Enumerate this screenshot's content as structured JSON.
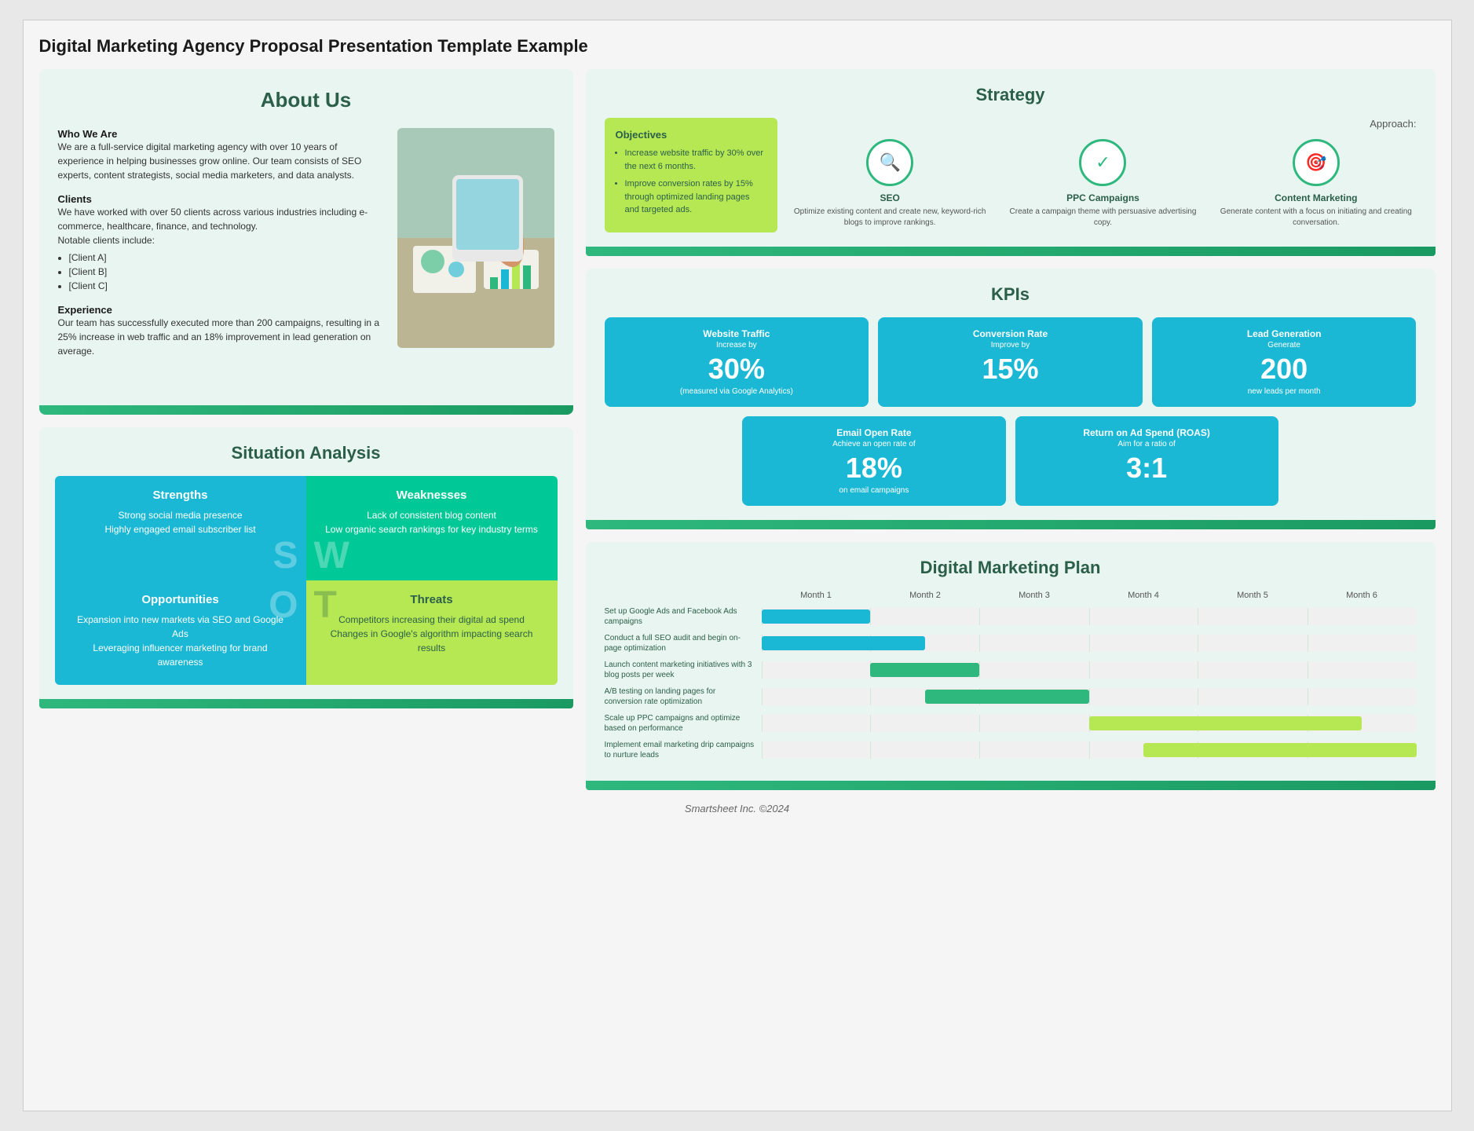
{
  "page": {
    "title": "Digital Marketing Agency Proposal Presentation Template Example",
    "footer": "Smartsheet Inc. ©2024"
  },
  "about": {
    "title": "About Us",
    "sections": [
      {
        "title": "Who We Are",
        "body": "We are a full-service digital marketing agency with over 10 years of experience in helping businesses grow online. Our team consists of SEO experts, content strategists, social media marketers, and data analysts."
      },
      {
        "title": "Clients",
        "body": "We have worked with over 50 clients across various industries including e-commerce, healthcare, finance, and technology.",
        "notable": "Notable clients include:",
        "clients": [
          "[Client A]",
          "[Client B]",
          "[Client C]"
        ]
      },
      {
        "title": "Experience",
        "body": "Our team has successfully executed more than 200 campaigns, resulting in a 25% increase in web traffic and an 18% improvement in lead generation on average."
      }
    ]
  },
  "situation": {
    "title": "Situation Analysis",
    "swot": {
      "strengths": {
        "title": "Strengths",
        "letter": "S",
        "items": [
          "Strong social media presence",
          "Highly engaged email subscriber list"
        ]
      },
      "weaknesses": {
        "title": "Weaknesses",
        "letter": "W",
        "items": [
          "Lack of consistent blog content",
          "Low organic search rankings for key industry terms"
        ]
      },
      "opportunities": {
        "title": "Opportunities",
        "letter": "O",
        "items": [
          "Expansion into new markets via SEO and Google Ads",
          "Leveraging influencer marketing for brand awareness"
        ]
      },
      "threats": {
        "title": "Threats",
        "letter": "T",
        "items": [
          "Competitors increasing their digital ad spend",
          "Changes in Google's algorithm impacting search results"
        ]
      }
    }
  },
  "strategy": {
    "title": "Strategy",
    "objectives": {
      "title": "Objectives",
      "items": [
        "Increase website traffic by 30% over the next 6 months.",
        "Improve conversion rates by 15% through optimized landing pages and targeted ads."
      ]
    },
    "approach_label": "Approach:",
    "approaches": [
      {
        "icon": "🔍",
        "title": "SEO",
        "body": "Optimize existing content and create new, keyword-rich blogs to improve rankings."
      },
      {
        "icon": "✓",
        "title": "PPC Campaigns",
        "body": "Create a campaign theme with persuasive advertising copy."
      },
      {
        "icon": "🎯",
        "title": "Content Marketing",
        "body": "Generate content with a focus on initiating and creating conversation."
      }
    ]
  },
  "kpis": {
    "title": "KPIs",
    "items": [
      {
        "label": "Website Traffic",
        "sub": "Increase by",
        "value": "30%",
        "unit": "(measured via Google Analytics)"
      },
      {
        "label": "Conversion Rate",
        "sub": "Improve by",
        "value": "15%",
        "unit": ""
      },
      {
        "label": "Lead Generation",
        "sub": "Generate",
        "value": "200",
        "unit": "new leads per month"
      },
      {
        "label": "Email Open Rate",
        "sub": "Achieve an open rate of",
        "value": "18%",
        "unit": "on email campaigns"
      },
      {
        "label": "Return on Ad Spend (ROAS)",
        "sub": "Aim for a ratio of",
        "value": "3:1",
        "unit": ""
      }
    ]
  },
  "dmp": {
    "title": "Digital Marketing Plan",
    "months": [
      "Month 1",
      "Month 2",
      "Month 3",
      "Month 4",
      "Month 5",
      "Month 6"
    ],
    "tasks": [
      {
        "label": "Set up Google Ads and Facebook Ads campaigns",
        "start": 0,
        "span": 1,
        "color": "teal"
      },
      {
        "label": "Conduct a full SEO audit and begin on-page optimization",
        "start": 0,
        "span": 1.5,
        "color": "teal"
      },
      {
        "label": "Launch content marketing initiatives with 3 blog posts per week",
        "start": 1,
        "span": 1,
        "color": "green"
      },
      {
        "label": "A/B testing on landing pages for conversion rate optimization",
        "start": 1.5,
        "span": 1.5,
        "color": "green"
      },
      {
        "label": "Scale up PPC campaigns and optimize based on performance",
        "start": 3,
        "span": 2.5,
        "color": "lime"
      },
      {
        "label": "Implement email marketing drip campaigns to nurture leads",
        "start": 3.5,
        "span": 2.5,
        "color": "lime"
      }
    ]
  }
}
